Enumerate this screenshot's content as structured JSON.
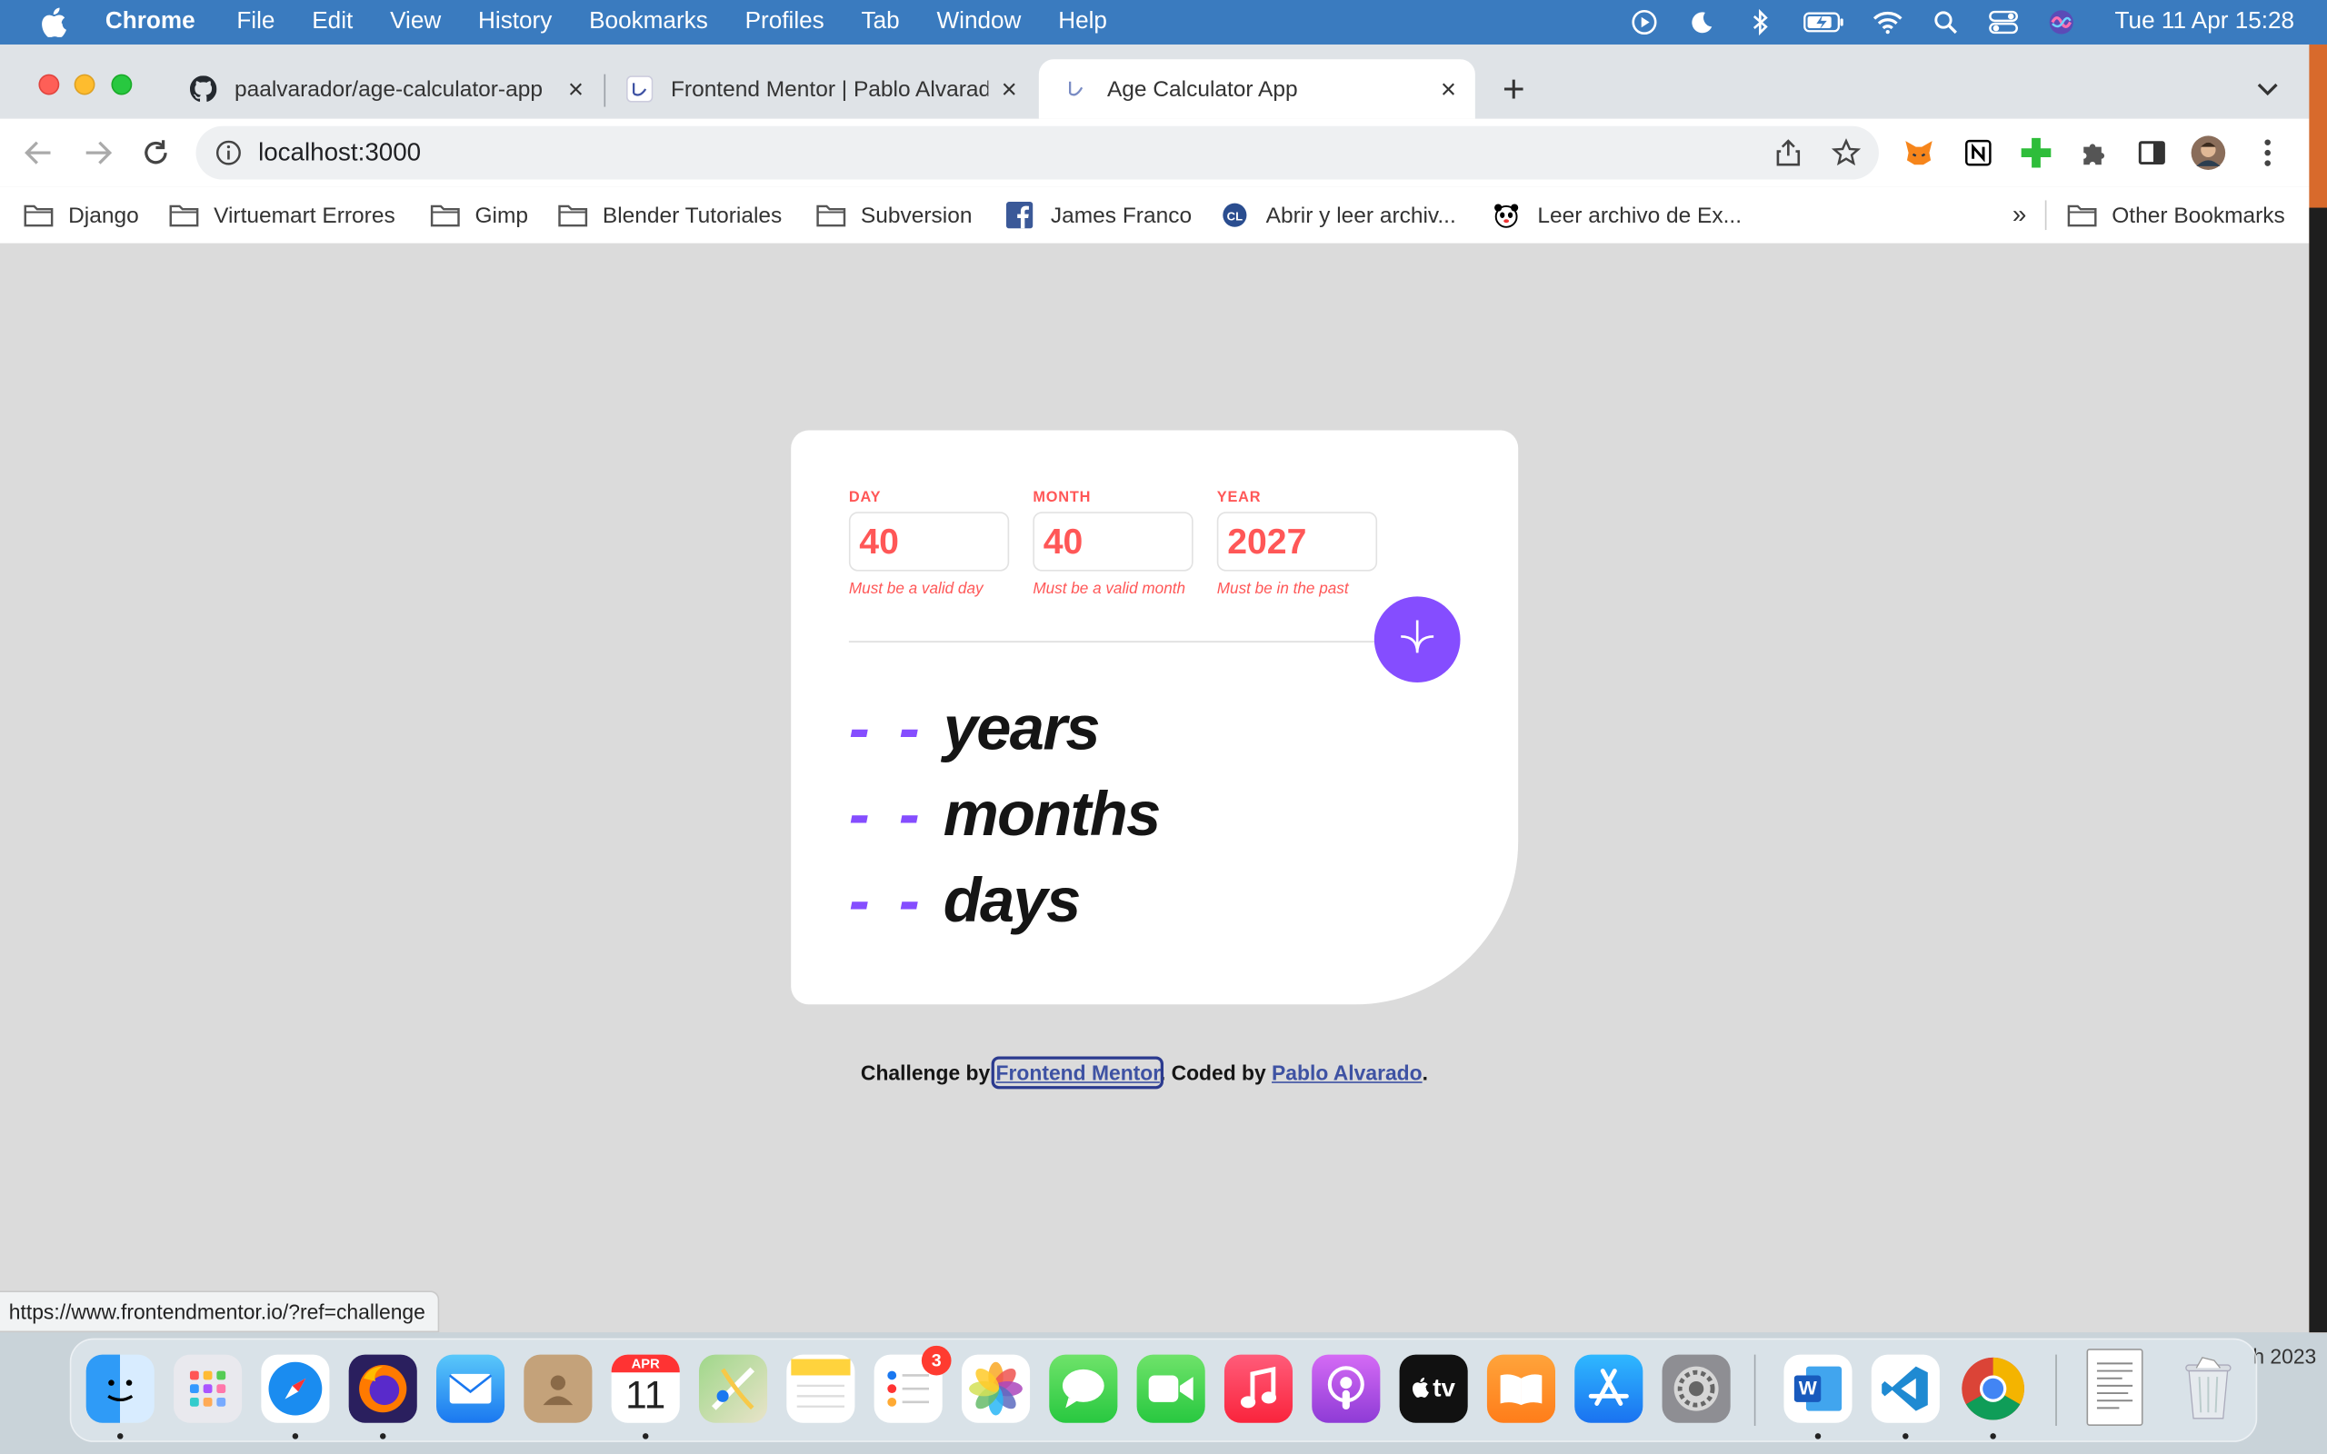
{
  "menubar": {
    "app": "Chrome",
    "items": [
      "File",
      "Edit",
      "View",
      "History",
      "Bookmarks",
      "Profiles",
      "Tab",
      "Window",
      "Help"
    ],
    "clock": "Tue 11 Apr  15:28"
  },
  "tabs": [
    {
      "title": "paalvarador/age-calculator-app",
      "icon": "github-icon"
    },
    {
      "title": "Frontend Mentor | Pablo Alvarado",
      "icon": "frontend-mentor-favicon"
    },
    {
      "title": "Age Calculator App",
      "icon": "age-calculator-favicon",
      "active": true
    }
  ],
  "toolbar": {
    "url": "localhost:3000"
  },
  "bookmarks": [
    {
      "label": "Django",
      "icon": "folder-icon"
    },
    {
      "label": "Virtuemart Errores",
      "icon": "folder-icon"
    },
    {
      "label": "Gimp",
      "icon": "folder-icon"
    },
    {
      "label": "Blender Tutoriales",
      "icon": "folder-icon"
    },
    {
      "label": "Subversion",
      "icon": "folder-icon"
    },
    {
      "label": "James Franco",
      "icon": "facebook-icon"
    },
    {
      "label": "Abrir y leer archiv...",
      "icon": "cl-icon"
    },
    {
      "label": "Leer archivo de Ex...",
      "icon": "panda-icon"
    }
  ],
  "bookmarks_overflow": "»",
  "other_bookmarks": "Other Bookmarks",
  "calculator": {
    "fields": [
      {
        "label": "DAY",
        "value": "40",
        "error": "Must be a valid day"
      },
      {
        "label": "MONTH",
        "value": "40",
        "error": "Must be a valid month"
      },
      {
        "label": "YEAR",
        "value": "2027",
        "error": "Must be in the past"
      }
    ],
    "results": [
      {
        "value": "- -",
        "unit": "years"
      },
      {
        "value": "- -",
        "unit": "months"
      },
      {
        "value": "- -",
        "unit": "days"
      }
    ],
    "accent": "#854dff",
    "error_color": "#ff5757"
  },
  "attribution": {
    "prefix": "Challenge by",
    "link1": "Frontend Mentor",
    "middle": ". Coded by",
    "link2": "Pablo Alvarado",
    "suffix": "."
  },
  "status_url": "https://www.frontendmentor.io/?ref=challenge",
  "desktop_partial_text": "h 2023",
  "dock": {
    "apps": [
      "Finder",
      "Launchpad",
      "Safari",
      "Firefox",
      "Mail",
      "Contacts",
      "Calendar",
      "Maps",
      "Notes",
      "Reminders",
      "Photos",
      "Messages",
      "FaceTime",
      "Music",
      "Podcasts",
      "TV",
      "Books",
      "App Store",
      "System Settings",
      "Word",
      "VS Code",
      "Chrome",
      "Document",
      "Trash"
    ],
    "calendar_month": "APR",
    "calendar_day": "11",
    "reminders_badge": "3",
    "tv_label": "tv",
    "word_label": "W"
  }
}
